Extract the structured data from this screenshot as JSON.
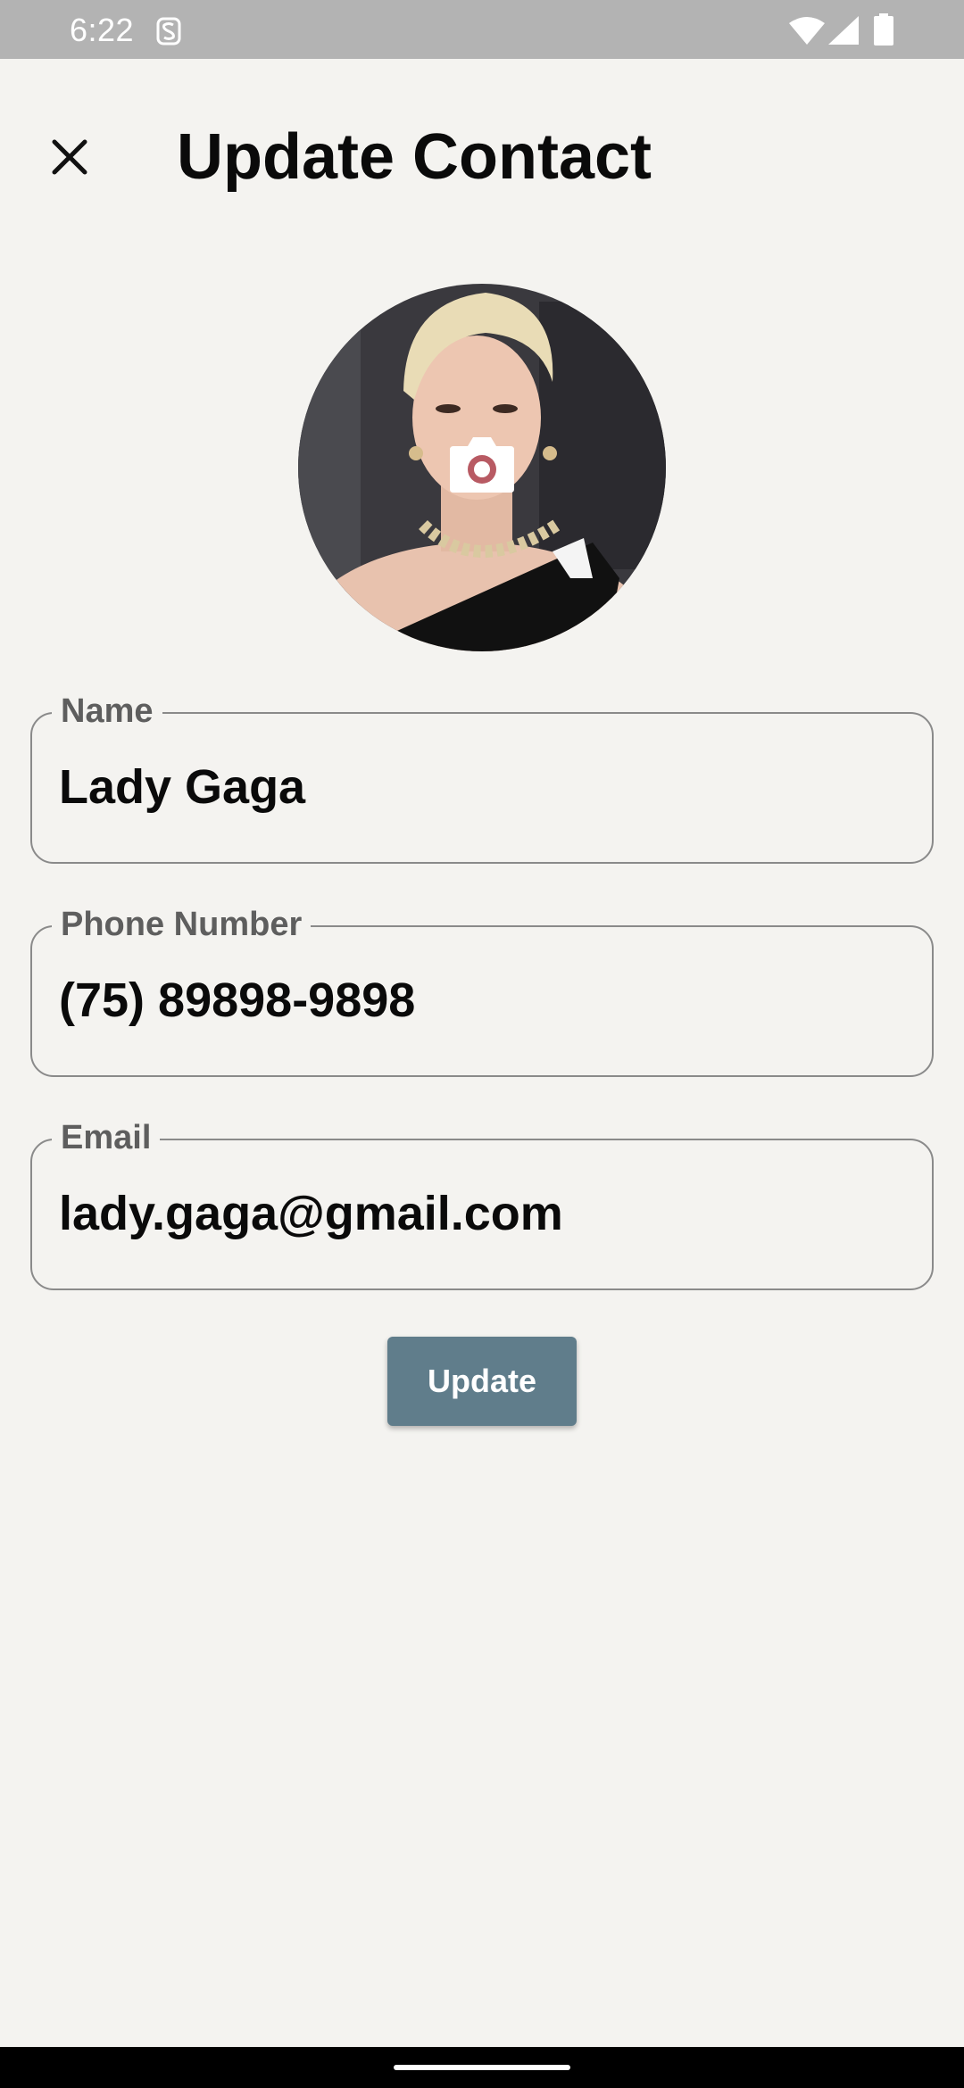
{
  "status_bar": {
    "time": "6:22",
    "icons": [
      "s-app-icon",
      "wifi-icon",
      "signal-icon",
      "battery-icon"
    ]
  },
  "header": {
    "title": "Update Contact",
    "close_icon": "close-icon"
  },
  "avatar": {
    "overlay_icon": "camera-icon"
  },
  "form": {
    "name": {
      "label": "Name",
      "value": "Lady Gaga"
    },
    "phone": {
      "label": "Phone Number",
      "value": "(75) 89898-9898"
    },
    "email": {
      "label": "Email",
      "value": "lady.gaga@gmail.com"
    }
  },
  "actions": {
    "update_label": "Update"
  },
  "colors": {
    "background": "#f4f3f0",
    "button": "#607d8b",
    "field_border": "#8a8a8a",
    "status_bar": "#b3b3b3"
  }
}
